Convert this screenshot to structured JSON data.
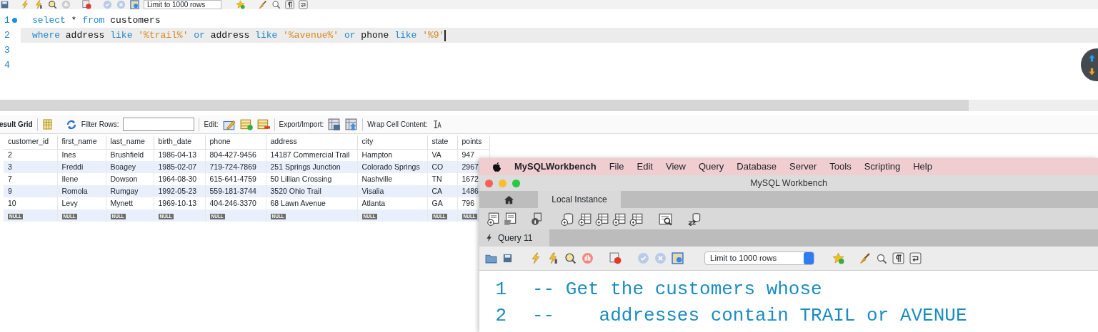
{
  "toolbar": {
    "limit": "Limit to 1000 rows"
  },
  "editor": {
    "lines": [
      {
        "number": "1",
        "marker": true,
        "highlighted": false,
        "tokens": [
          {
            "kind": "keyword",
            "text": "select"
          },
          {
            "kind": "plain",
            "text": " * "
          },
          {
            "kind": "keyword",
            "text": "from"
          },
          {
            "kind": "plain",
            "text": " customers"
          }
        ]
      },
      {
        "number": "2",
        "marker": false,
        "highlighted": true,
        "tokens": [
          {
            "kind": "keyword",
            "text": "where"
          },
          {
            "kind": "plain",
            "text": " address "
          },
          {
            "kind": "keyword",
            "text": "like "
          },
          {
            "kind": "string",
            "text": "'%trail%' "
          },
          {
            "kind": "keyword",
            "text": "or"
          },
          {
            "kind": "plain",
            "text": " address "
          },
          {
            "kind": "keyword",
            "text": "like "
          },
          {
            "kind": "string",
            "text": "'%avenue%' "
          },
          {
            "kind": "keyword",
            "text": "or"
          },
          {
            "kind": "plain",
            "text": " phone "
          },
          {
            "kind": "keyword",
            "text": "like "
          },
          {
            "kind": "string",
            "text": "'%9'"
          }
        ]
      },
      {
        "number": "3",
        "marker": false,
        "highlighted": false
      },
      {
        "number": "4",
        "marker": false,
        "highlighted": false
      }
    ]
  },
  "result_toolbar": {
    "title": "esult Grid",
    "filter_label": "Filter Rows:",
    "edit_label": "Edit:",
    "export_label": "Export/Import:",
    "wrap_label": "Wrap Cell Content:"
  },
  "table": {
    "columns": [
      "customer_id",
      "first_name",
      "last_name",
      "birth_date",
      "phone",
      "address",
      "city",
      "state",
      "points"
    ],
    "rows": [
      [
        "2",
        "Ines",
        "Brushfield",
        "1986-04-13",
        "804-427-9456",
        "14187 Commercial Trail",
        "Hampton",
        "VA",
        "947"
      ],
      [
        "3",
        "Freddi",
        "Boagey",
        "1985-02-07",
        "719-724-7869",
        "251 Springs Junction",
        "Colorado Springs",
        "CO",
        "2967"
      ],
      [
        "7",
        "Ilene",
        "Dowson",
        "1964-08-30",
        "615-641-4759",
        "50 Lillian Crossing",
        "Nashville",
        "TN",
        "1672"
      ],
      [
        "9",
        "Romola",
        "Rumgay",
        "1992-05-23",
        "559-181-3744",
        "3520 Ohio Trail",
        "Visalia",
        "CA",
        "1486"
      ],
      [
        "10",
        "Levy",
        "Mynett",
        "1969-10-13",
        "404-246-3370",
        "68 Lawn Avenue",
        "Atlanta",
        "GA",
        "796"
      ],
      [
        "NULL",
        "NULL",
        "NULL",
        "NULL",
        "NULL",
        "NULL",
        "NULL",
        "NULL",
        "NULL"
      ]
    ]
  },
  "overlay": {
    "menu_bar": {
      "app": "MySQLWorkbench",
      "items": [
        "File",
        "Edit",
        "View",
        "Query",
        "Database",
        "Server",
        "Tools",
        "Scripting",
        "Help"
      ]
    },
    "window": {
      "title": "MySQL Workbench"
    },
    "connection_tab": {
      "label": "Local Instance",
      "selected": true
    },
    "query_tab": {
      "label": "Query 11"
    },
    "limit": "Limit to 1000 rows",
    "editor": {
      "lines": [
        {
          "number": "1",
          "text": "-- Get the customers whose"
        },
        {
          "number": "2",
          "text": "--    addresses contain TRAIL or AVENUE"
        }
      ]
    }
  }
}
